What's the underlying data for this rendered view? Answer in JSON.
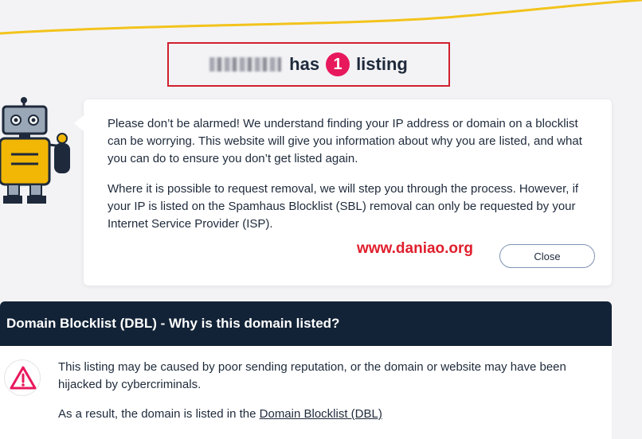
{
  "headline": {
    "suffix_pre": "has",
    "count": "1",
    "suffix_post": "listing"
  },
  "message": {
    "paragraph1": "Please don’t be alarmed! We understand finding your IP address or domain on a blocklist can be worrying. This website will give you information about why you are listed, and what you can do to ensure you don’t get listed again.",
    "paragraph2": "Where it is possible to request removal, we will step you through the process. However, if your IP is listed on the Spamhaus Blocklist (SBL) removal can only be requested by your Internet Service Provider (ISP).",
    "close_label": "Close"
  },
  "watermark": "www.daniao.org",
  "dbl": {
    "title": "Domain Blocklist (DBL) - Why is this domain listed?",
    "text1": "This listing may be caused by poor sending reputation, or the domain or website may have been hijacked by cybercriminals.",
    "text2_prefix": "As a result, the domain is listed in the ",
    "text2_link": "Domain Blocklist (DBL)"
  },
  "colors": {
    "accent_pink": "#e8185c",
    "navy": "#132337",
    "highlight_red": "#d0202e",
    "wave_yellow": "#f2c31b"
  }
}
